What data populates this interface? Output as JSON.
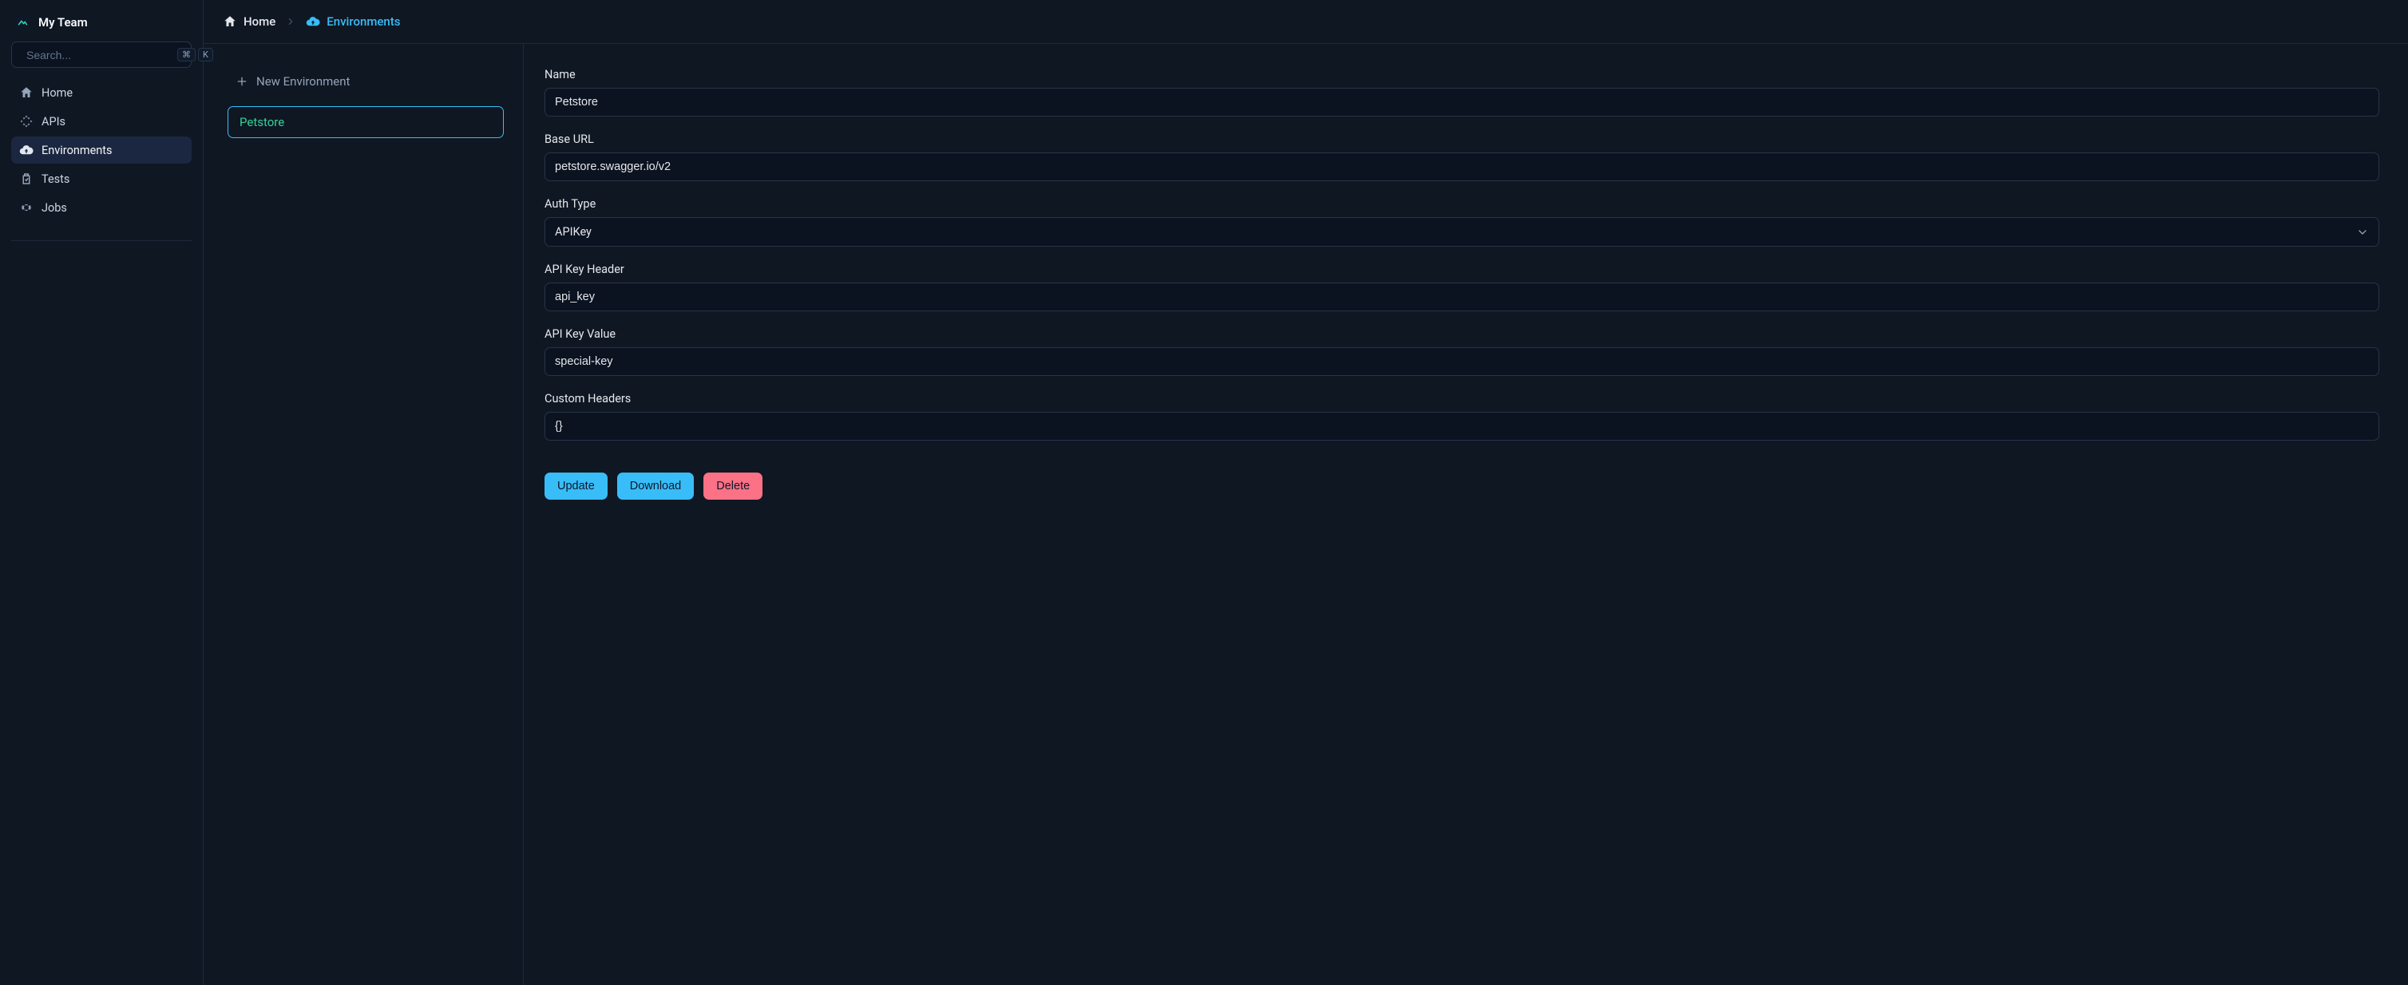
{
  "team": {
    "name": "My Team"
  },
  "search": {
    "placeholder": "Search...",
    "kbd1": "⌘",
    "kbd2": "K"
  },
  "sidebar": {
    "items": [
      {
        "label": "Home"
      },
      {
        "label": "APIs"
      },
      {
        "label": "Environments"
      },
      {
        "label": "Tests"
      },
      {
        "label": "Jobs"
      }
    ]
  },
  "breadcrumbs": {
    "home": "Home",
    "current": "Environments"
  },
  "env_list": {
    "new_label": "New Environment",
    "items": [
      {
        "label": "Petstore"
      }
    ]
  },
  "form": {
    "name": {
      "label": "Name",
      "value": "Petstore"
    },
    "base_url": {
      "label": "Base URL",
      "value": "petstore.swagger.io/v2"
    },
    "auth_type": {
      "label": "Auth Type",
      "value": "APIKey"
    },
    "api_key_header": {
      "label": "API Key Header",
      "value": "api_key"
    },
    "api_key_value": {
      "label": "API Key Value",
      "value": "special-key"
    },
    "custom_headers": {
      "label": "Custom Headers",
      "value": "{}"
    }
  },
  "actions": {
    "update": "Update",
    "download": "Download",
    "delete": "Delete"
  }
}
